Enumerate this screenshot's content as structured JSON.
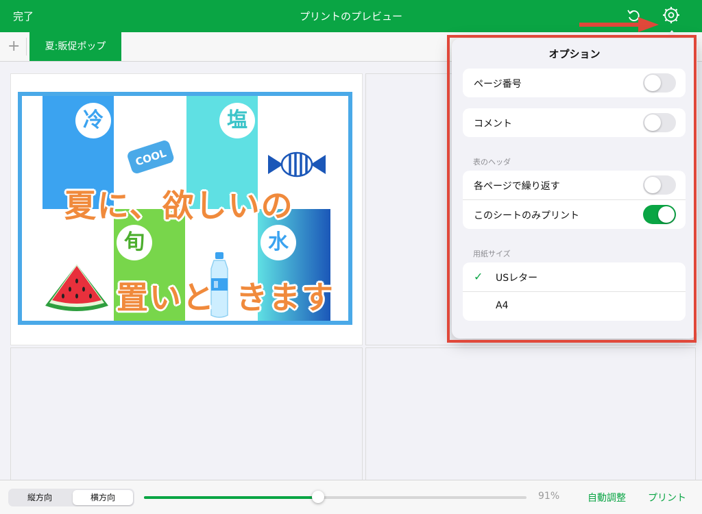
{
  "topbar": {
    "done_label": "完了",
    "title": "プリントのプレビュー",
    "undo_icon": "undo-icon",
    "settings_icon": "gear-icon"
  },
  "tabs": {
    "add_icon": "plus-icon",
    "sheet_tab": "夏:販促ポップ"
  },
  "poster": {
    "kanji": [
      "冷",
      "塩",
      "旬",
      "水"
    ],
    "line1": "夏に、欲しいの",
    "line2_a": "置いと",
    "line2_b": "きます",
    "cool_label": "COOL",
    "colors": {
      "border": "#4aa9e8",
      "blue": "#3ba3f0",
      "teal": "#5fe0e3",
      "green": "#78d64b",
      "navy": "#1b57b8",
      "orange": "#f08a3c"
    }
  },
  "options": {
    "title": "オプション",
    "page_number_label": "ページ番号",
    "page_number_on": false,
    "comment_label": "コメント",
    "comment_on": false,
    "header_section": "表のヘッダ",
    "repeat_label": "各ページで繰り返す",
    "repeat_on": false,
    "this_sheet_label": "このシートのみプリント",
    "this_sheet_on": true,
    "paper_section": "用紙サイズ",
    "paper_options": [
      "USレター",
      "A4"
    ],
    "paper_selected": "USレター"
  },
  "bottombar": {
    "portrait_label": "縦方向",
    "landscape_label": "横方向",
    "selected_orientation": "横方向",
    "zoom_value": 0.91,
    "zoom_label": "91%",
    "autofit_label": "自動調整",
    "print_label": "プリント"
  },
  "accent_color": "#0aa544",
  "highlight_color": "#e0483a"
}
